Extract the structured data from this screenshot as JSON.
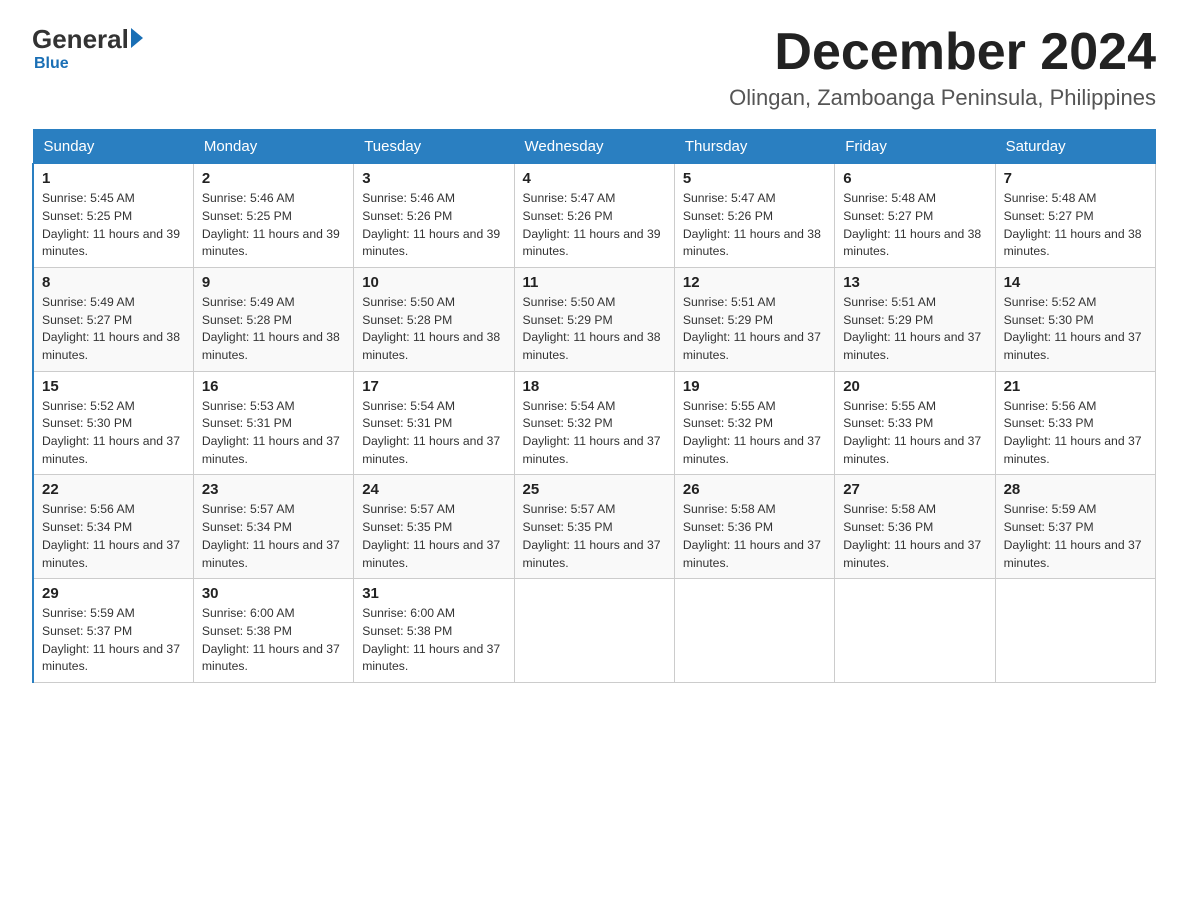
{
  "logo": {
    "general": "General",
    "blue": "Blue"
  },
  "title": {
    "month": "December 2024",
    "location": "Olingan, Zamboanga Peninsula, Philippines"
  },
  "headers": [
    "Sunday",
    "Monday",
    "Tuesday",
    "Wednesday",
    "Thursday",
    "Friday",
    "Saturday"
  ],
  "weeks": [
    [
      {
        "day": "1",
        "sunrise": "5:45 AM",
        "sunset": "5:25 PM",
        "daylight": "11 hours and 39 minutes."
      },
      {
        "day": "2",
        "sunrise": "5:46 AM",
        "sunset": "5:25 PM",
        "daylight": "11 hours and 39 minutes."
      },
      {
        "day": "3",
        "sunrise": "5:46 AM",
        "sunset": "5:26 PM",
        "daylight": "11 hours and 39 minutes."
      },
      {
        "day": "4",
        "sunrise": "5:47 AM",
        "sunset": "5:26 PM",
        "daylight": "11 hours and 39 minutes."
      },
      {
        "day": "5",
        "sunrise": "5:47 AM",
        "sunset": "5:26 PM",
        "daylight": "11 hours and 38 minutes."
      },
      {
        "day": "6",
        "sunrise": "5:48 AM",
        "sunset": "5:27 PM",
        "daylight": "11 hours and 38 minutes."
      },
      {
        "day": "7",
        "sunrise": "5:48 AM",
        "sunset": "5:27 PM",
        "daylight": "11 hours and 38 minutes."
      }
    ],
    [
      {
        "day": "8",
        "sunrise": "5:49 AM",
        "sunset": "5:27 PM",
        "daylight": "11 hours and 38 minutes."
      },
      {
        "day": "9",
        "sunrise": "5:49 AM",
        "sunset": "5:28 PM",
        "daylight": "11 hours and 38 minutes."
      },
      {
        "day": "10",
        "sunrise": "5:50 AM",
        "sunset": "5:28 PM",
        "daylight": "11 hours and 38 minutes."
      },
      {
        "day": "11",
        "sunrise": "5:50 AM",
        "sunset": "5:29 PM",
        "daylight": "11 hours and 38 minutes."
      },
      {
        "day": "12",
        "sunrise": "5:51 AM",
        "sunset": "5:29 PM",
        "daylight": "11 hours and 37 minutes."
      },
      {
        "day": "13",
        "sunrise": "5:51 AM",
        "sunset": "5:29 PM",
        "daylight": "11 hours and 37 minutes."
      },
      {
        "day": "14",
        "sunrise": "5:52 AM",
        "sunset": "5:30 PM",
        "daylight": "11 hours and 37 minutes."
      }
    ],
    [
      {
        "day": "15",
        "sunrise": "5:52 AM",
        "sunset": "5:30 PM",
        "daylight": "11 hours and 37 minutes."
      },
      {
        "day": "16",
        "sunrise": "5:53 AM",
        "sunset": "5:31 PM",
        "daylight": "11 hours and 37 minutes."
      },
      {
        "day": "17",
        "sunrise": "5:54 AM",
        "sunset": "5:31 PM",
        "daylight": "11 hours and 37 minutes."
      },
      {
        "day": "18",
        "sunrise": "5:54 AM",
        "sunset": "5:32 PM",
        "daylight": "11 hours and 37 minutes."
      },
      {
        "day": "19",
        "sunrise": "5:55 AM",
        "sunset": "5:32 PM",
        "daylight": "11 hours and 37 minutes."
      },
      {
        "day": "20",
        "sunrise": "5:55 AM",
        "sunset": "5:33 PM",
        "daylight": "11 hours and 37 minutes."
      },
      {
        "day": "21",
        "sunrise": "5:56 AM",
        "sunset": "5:33 PM",
        "daylight": "11 hours and 37 minutes."
      }
    ],
    [
      {
        "day": "22",
        "sunrise": "5:56 AM",
        "sunset": "5:34 PM",
        "daylight": "11 hours and 37 minutes."
      },
      {
        "day": "23",
        "sunrise": "5:57 AM",
        "sunset": "5:34 PM",
        "daylight": "11 hours and 37 minutes."
      },
      {
        "day": "24",
        "sunrise": "5:57 AM",
        "sunset": "5:35 PM",
        "daylight": "11 hours and 37 minutes."
      },
      {
        "day": "25",
        "sunrise": "5:57 AM",
        "sunset": "5:35 PM",
        "daylight": "11 hours and 37 minutes."
      },
      {
        "day": "26",
        "sunrise": "5:58 AM",
        "sunset": "5:36 PM",
        "daylight": "11 hours and 37 minutes."
      },
      {
        "day": "27",
        "sunrise": "5:58 AM",
        "sunset": "5:36 PM",
        "daylight": "11 hours and 37 minutes."
      },
      {
        "day": "28",
        "sunrise": "5:59 AM",
        "sunset": "5:37 PM",
        "daylight": "11 hours and 37 minutes."
      }
    ],
    [
      {
        "day": "29",
        "sunrise": "5:59 AM",
        "sunset": "5:37 PM",
        "daylight": "11 hours and 37 minutes."
      },
      {
        "day": "30",
        "sunrise": "6:00 AM",
        "sunset": "5:38 PM",
        "daylight": "11 hours and 37 minutes."
      },
      {
        "day": "31",
        "sunrise": "6:00 AM",
        "sunset": "5:38 PM",
        "daylight": "11 hours and 37 minutes."
      },
      null,
      null,
      null,
      null
    ]
  ]
}
